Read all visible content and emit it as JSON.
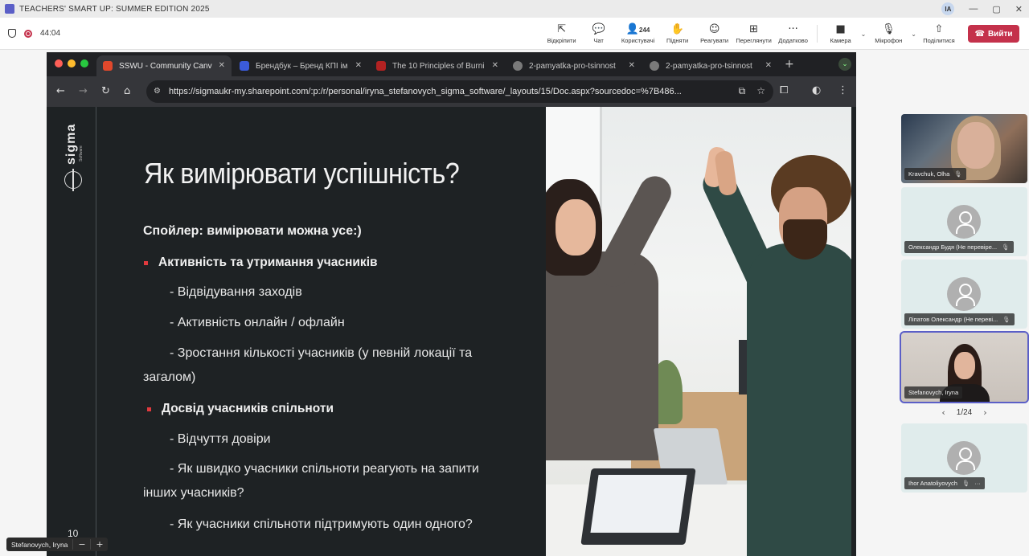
{
  "window": {
    "title": "TEACHERS' SMART UP: SUMMER EDITION 2025",
    "user_initials": "IA",
    "controls": [
      "—",
      "▢",
      "✕"
    ]
  },
  "meeting": {
    "timer": "44:04",
    "tools": [
      {
        "label": "Відкріпити",
        "icon": "unpin-icon",
        "glyph": "⇱"
      },
      {
        "label": "Чат",
        "icon": "chat-icon",
        "glyph": "💬"
      },
      {
        "label": "Користувачі",
        "icon": "people-icon",
        "glyph": "👤",
        "count": "244"
      },
      {
        "label": "Підняти",
        "icon": "raise-hand-icon",
        "glyph": "✋"
      },
      {
        "label": "Реагувати",
        "icon": "react-icon",
        "glyph": "☺"
      },
      {
        "label": "Переглянути",
        "icon": "view-icon",
        "glyph": "⊞"
      },
      {
        "label": "Додатково",
        "icon": "more-icon",
        "glyph": "···"
      }
    ],
    "camera_label": "Камера",
    "mic_label": "Мікрофон",
    "share_label": "Поділитися",
    "leave_label": "Вийти",
    "accent": "#c4314b"
  },
  "browser": {
    "tabs": [
      {
        "title": "SSWU - Community Canv",
        "active": true,
        "favicon_color": "#e0482c"
      },
      {
        "title": "Брендбук – Бренд КПІ ім",
        "active": false,
        "favicon_color": "#3b5bdb"
      },
      {
        "title": "The 10 Principles of Burni",
        "active": false,
        "favicon_color": "#b22222"
      },
      {
        "title": "2-pamyatka-pro-tsinnost",
        "active": false,
        "favicon_color": "#7a7a7a"
      },
      {
        "title": "2-pamyatka-pro-tsinnost",
        "active": false,
        "favicon_color": "#7a7a7a"
      }
    ],
    "url": "https://sigmaukr-my.sharepoint.com/:p:/r/personal/iryna_stefanovych_sigma_software/_layouts/15/Doc.aspx?sourcedoc=%7B486..."
  },
  "slide": {
    "logo": "sigma",
    "logo_sub": "Software",
    "title": "Як вимірювати успішність?",
    "spoiler": "Спойлер: вимірювати можна усе:)",
    "bullet1": "Активність та утримання учасників",
    "b1_items": [
      "- Відвідування заходів",
      "- Активність онлайн / офлайн",
      "- Зростання кількості учасників (у певній локації та",
      "загалом)"
    ],
    "bullet2": "Досвід учасників спільноти",
    "b2_items": [
      "- Відчуття довіри",
      "- Як швидко учасники спільноти реагують на запити",
      "інших учасників?",
      "- Як учасники спільноти підтримують один одного?"
    ],
    "number": "10",
    "accent": "#e03a3e"
  },
  "presenter": {
    "name": "Stefanovych, Iryna",
    "zoom_out": "−",
    "zoom_in": "+"
  },
  "participants": [
    {
      "name": "Kravchuk, Olha",
      "video": true
    },
    {
      "name": "Олександр Будя (Не перевіре...",
      "video": false
    },
    {
      "name": "Ліпатов Олександр (Не переві...",
      "video": false
    },
    {
      "name": "Stefanovych, Iryna",
      "video": true
    },
    {
      "name": "Ihor Anatoliyovych",
      "video": false
    }
  ],
  "pager": "1/24"
}
